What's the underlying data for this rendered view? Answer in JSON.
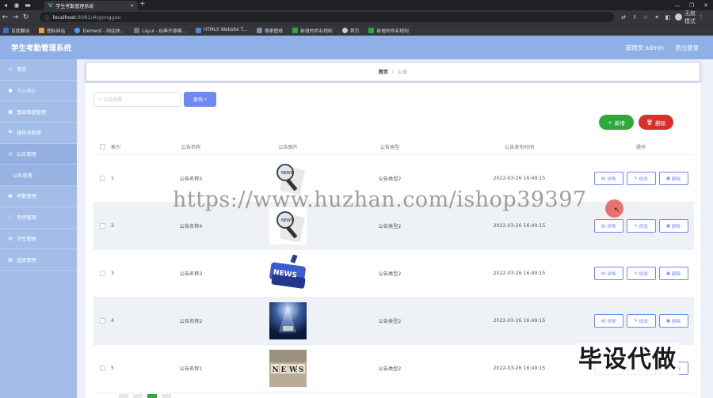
{
  "browser": {
    "tab_title": "学生考勤管理系统",
    "url_host": "localhost",
    "url_path": ":8081/#/gonggao",
    "profile": "无痕模式",
    "bookmarks": [
      "百度翻译",
      "图标网站",
      "Element - 网站快...",
      "Layui - 经典开源模...",
      "HTML5 Website T...",
      "搜索壁纸",
      "新增的命名规则",
      "首页",
      "新增的命名规则"
    ]
  },
  "header": {
    "title": "学生考勤管理系统",
    "admin": "管理员 admin",
    "logout": "退出登录"
  },
  "sidebar": {
    "items": [
      {
        "label": "首页",
        "icon": "home-icon"
      },
      {
        "label": "个人中心",
        "icon": "user-icon"
      },
      {
        "label": "基础数据管理",
        "icon": "data-icon"
      },
      {
        "label": "辅导员管理",
        "icon": "flag-icon"
      },
      {
        "label": "公告管理",
        "icon": "notice-icon"
      },
      {
        "label": "公告管理",
        "icon": ""
      },
      {
        "label": "考勤管理",
        "icon": "check-icon"
      },
      {
        "label": "老师管理",
        "icon": "teacher-icon"
      },
      {
        "label": "学生管理",
        "icon": "student-icon"
      },
      {
        "label": "班级管理",
        "icon": "class-icon"
      }
    ]
  },
  "breadcrumb": {
    "home": "首页",
    "sep": "/",
    "current": "公告"
  },
  "search": {
    "placeholder": "公告名称",
    "button": "查询"
  },
  "actions": {
    "add": "新增",
    "delete": "删除"
  },
  "table": {
    "headers": [
      "索引",
      "公告名称",
      "公告图片",
      "公告类型",
      "公告发布时间",
      "操作"
    ],
    "rows": [
      {
        "index": "1",
        "name": "公告名称5",
        "type": "公告类型2",
        "time": "2022-03-26 16:49:15",
        "image": "magnifier-news"
      },
      {
        "index": "2",
        "name": "公告名称4",
        "type": "公告类型2",
        "time": "2022-03-26 16:49:15",
        "image": "magnifier-news"
      },
      {
        "index": "3",
        "name": "公告名称3",
        "type": "公告类型2",
        "time": "2022-03-26 16:49:15",
        "image": "news-button"
      },
      {
        "index": "4",
        "name": "公告名称2",
        "type": "公告类型2",
        "time": "2022-03-26 16:49:15",
        "image": "spotlight-stage"
      },
      {
        "index": "5",
        "name": "公告名称1",
        "type": "公告类型2",
        "time": "2022-03-26 16:49:15",
        "image": "news-letters"
      }
    ],
    "op_detail": "详情",
    "op_edit": "修改",
    "op_delete": "删除"
  },
  "overlay": {
    "watermark": "https://www.huzhan.com/ishop39397",
    "stamp": "毕设代做"
  },
  "colors": {
    "header": "#8fb0e6",
    "sidebar": "#a3bde8",
    "primary": "#6f89f2",
    "add": "#2fa93a",
    "delete": "#d9302c"
  }
}
